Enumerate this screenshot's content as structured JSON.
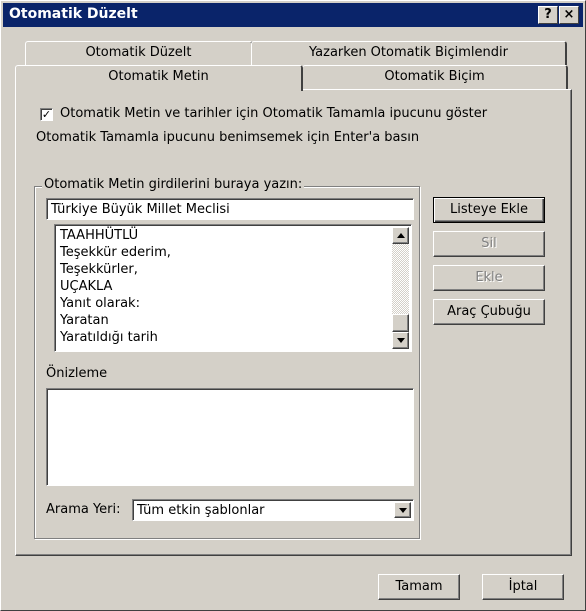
{
  "window": {
    "title": "Otomatik Düzelt",
    "help_button": "?",
    "close_button": "×"
  },
  "tabs": {
    "row_top": [
      "Otomatik Düzelt",
      "Yazarken Otomatik Biçimlendir"
    ],
    "row_bottom": [
      "Otomatik Metin",
      "Otomatik Biçim"
    ],
    "active": "Otomatik Metin"
  },
  "autotext": {
    "show_tip_checkbox": {
      "checked": true,
      "label": "Otomatik Metin ve tarihler için Otomatik Tamamla ipucunu göster",
      "check_glyph": "✓"
    },
    "enter_hint": "Otomatik Tamamla ipucunu benimsemek için Enter'a basın",
    "entries_group_label": "Otomatik Metin girdilerini buraya yazın:",
    "entry_input_value": "Türkiye Büyük Millet Meclisi",
    "list_items": [
      "TAAHHÜTLÜ",
      "Teşekkür ederim,",
      "Teşekkürler,",
      "UÇAKLA",
      "Yanıt olarak:",
      "Yaratan",
      "Yaratıldığı tarih"
    ],
    "buttons": {
      "add_to_list": "Listeye Ekle",
      "delete": "Sil",
      "insert": "Ekle",
      "toolbar": "Araç Çubuğu"
    },
    "preview_label": "Önizleme",
    "look_in_label": "Arama Yeri:",
    "look_in_value": "Tüm etkin şablonlar"
  },
  "footer": {
    "ok": "Tamam",
    "cancel": "İptal"
  }
}
